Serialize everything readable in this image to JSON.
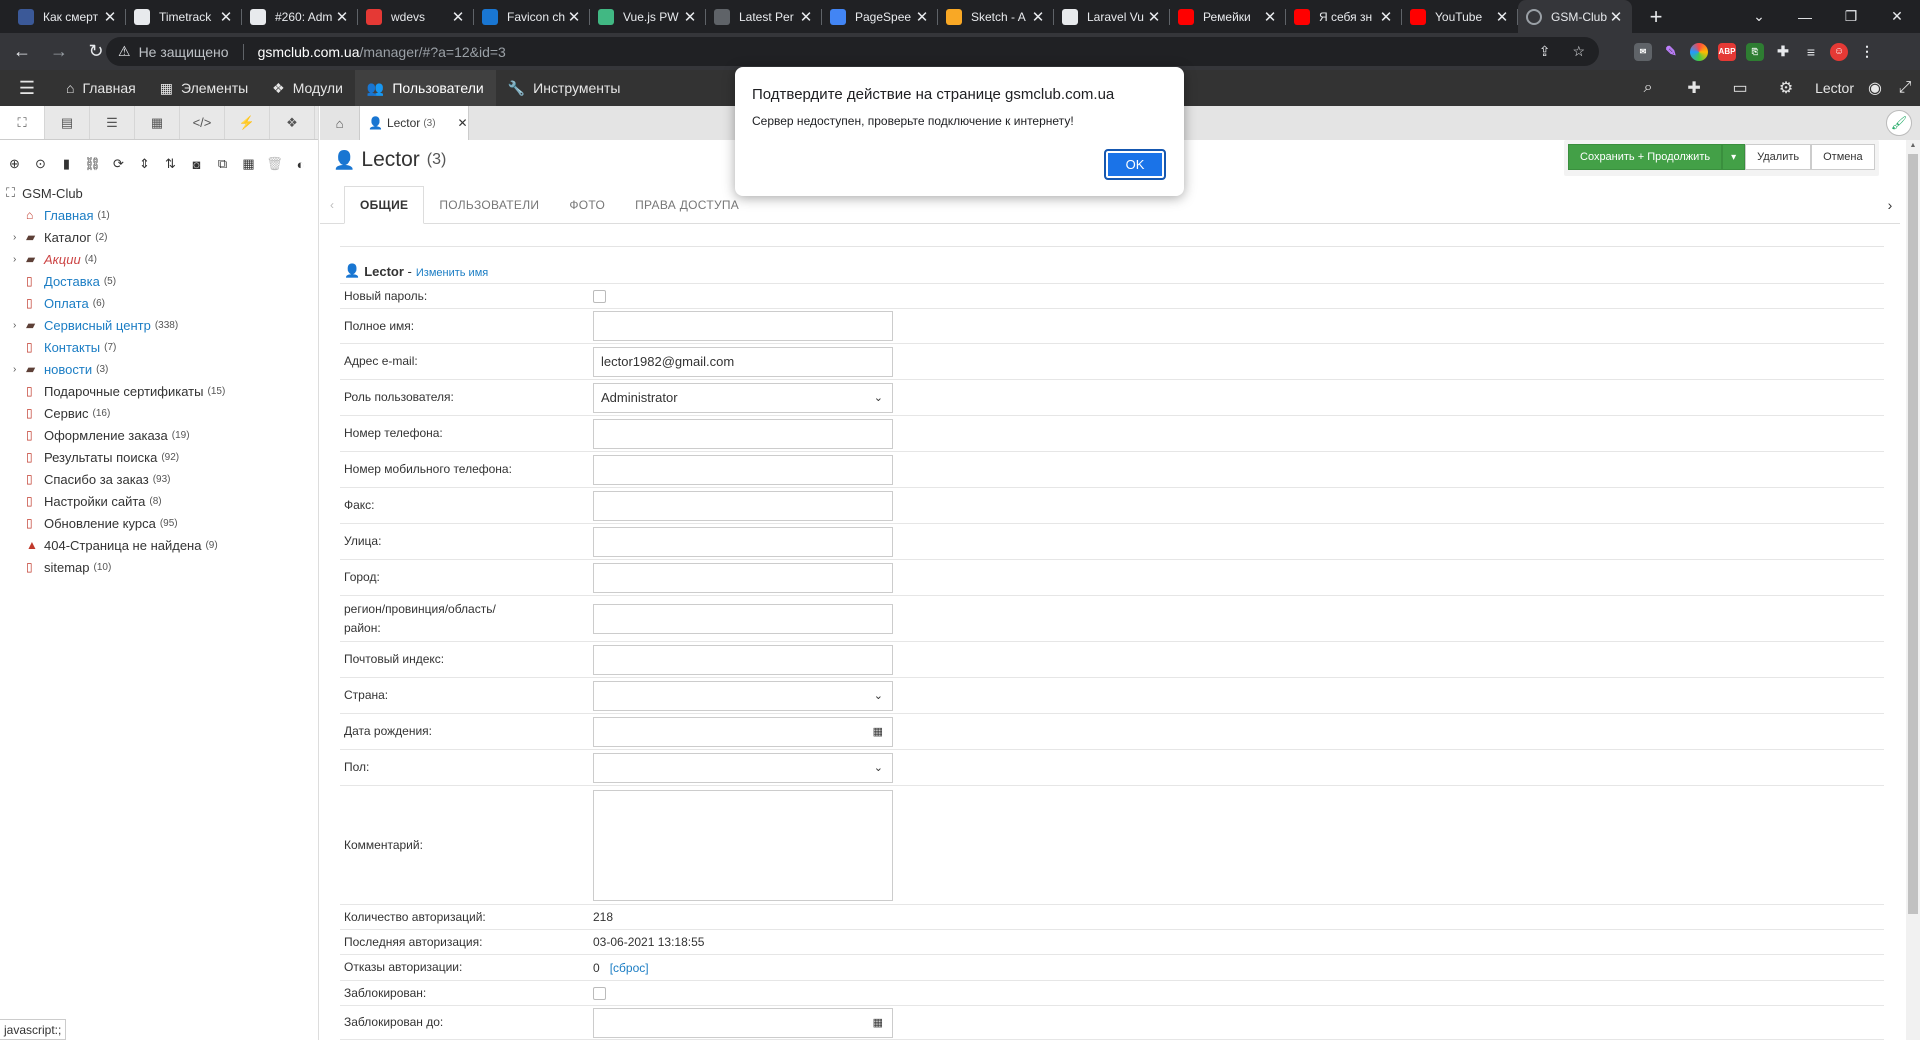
{
  "browser_tabs": [
    {
      "title": "Как смерт",
      "favicon_color": "#3b5998"
    },
    {
      "title": "Timetrack",
      "favicon_color": "#e8eaed"
    },
    {
      "title": "#260: Adm",
      "favicon_color": "#e8eaed"
    },
    {
      "title": "wdevs",
      "favicon_color": "#e53935"
    },
    {
      "title": "Favicon ch",
      "favicon_color": "#1976d2"
    },
    {
      "title": "Vue.js PW",
      "favicon_color": "#41b883"
    },
    {
      "title": "Latest Per",
      "favicon_color": "#5f6368"
    },
    {
      "title": "PageSpee",
      "favicon_color": "#4285f4"
    },
    {
      "title": "Sketch - A",
      "favicon_color": "#f9a825"
    },
    {
      "title": "Laravel Vu",
      "favicon_color": "#e8eaed"
    },
    {
      "title": "Ремейки",
      "favicon_color": "#ff0000"
    },
    {
      "title": "Я себя зн",
      "favicon_color": "#ff0000"
    },
    {
      "title": "YouTube",
      "favicon_color": "#ff0000"
    },
    {
      "title": "GSM-Club",
      "favicon_color": "#35363a",
      "active": true
    }
  ],
  "address_bar": {
    "security": "Не защищено",
    "host": "gsmclub.com.ua",
    "path": "/manager/#?a=12&id=3"
  },
  "main_nav": {
    "items": [
      {
        "label": "Главная",
        "icon": "home-icon"
      },
      {
        "label": "Элементы",
        "icon": "grid-icon"
      },
      {
        "label": "Модули",
        "icon": "cubes-icon"
      },
      {
        "label": "Пользователи",
        "icon": "users-icon",
        "active": true
      },
      {
        "label": "Инструменты",
        "icon": "wrench-icon"
      }
    ],
    "user": "Lector"
  },
  "tree": {
    "site": "GSM-Club",
    "nodes": [
      {
        "label": "Главная",
        "count": "(1)",
        "type": "home",
        "style": "link"
      },
      {
        "label": "Каталог",
        "count": "(2)",
        "type": "folder",
        "expandable": true
      },
      {
        "label": "Акции",
        "count": "(4)",
        "type": "folder",
        "expandable": true,
        "style": "em"
      },
      {
        "label": "Доставка",
        "count": "(5)",
        "type": "doc",
        "style": "link"
      },
      {
        "label": "Оплата",
        "count": "(6)",
        "type": "doc",
        "style": "link"
      },
      {
        "label": "Сервисный центр",
        "count": "(338)",
        "type": "folder",
        "expandable": true,
        "style": "link"
      },
      {
        "label": "Контакты",
        "count": "(7)",
        "type": "doc",
        "style": "link"
      },
      {
        "label": "новости",
        "count": "(3)",
        "type": "folder",
        "expandable": true,
        "style": "link"
      },
      {
        "label": "Подарочные сертификаты",
        "count": "(15)",
        "type": "doc"
      },
      {
        "label": "Сервис",
        "count": "(16)",
        "type": "doc"
      },
      {
        "label": "Оформление заказа",
        "count": "(19)",
        "type": "doc"
      },
      {
        "label": "Результаты поиска",
        "count": "(92)",
        "type": "doc"
      },
      {
        "label": "Спасибо за заказ",
        "count": "(93)",
        "type": "doc"
      },
      {
        "label": "Настройки сайта",
        "count": "(8)",
        "type": "doc"
      },
      {
        "label": "Обновление курса",
        "count": "(95)",
        "type": "doc"
      },
      {
        "label": "404-Страница не найдена",
        "count": "(9)",
        "type": "warning"
      },
      {
        "label": "sitemap",
        "count": "(10)",
        "type": "doc"
      }
    ]
  },
  "doc_tab": {
    "label": "Lector",
    "count": "(3)"
  },
  "page": {
    "title": "Lector",
    "count": "(3)"
  },
  "actions": {
    "save": "Сохранить + Продолжить",
    "delete": "Удалить",
    "cancel": "Отмена"
  },
  "form_tabs": [
    "ОБЩИЕ",
    "ПОЛЬЗОВАТЕЛИ",
    "ФОТО",
    "ПРАВА ДОСТУПА"
  ],
  "user_header": {
    "name": "Lector",
    "rename": "Изменить имя"
  },
  "fields": {
    "new_password": "Новый пароль:",
    "full_name": "Полное имя:",
    "email": "Адрес e-mail:",
    "email_value": "lector1982@gmail.com",
    "role": "Роль пользователя:",
    "role_value": "Administrator",
    "phone": "Номер телефона:",
    "mobile": "Номер мобильного телефона:",
    "fax": "Факс:",
    "street": "Улица:",
    "city": "Город:",
    "region": "регион/провинция/область/район:",
    "zip": "Почтовый индекс:",
    "country": "Страна:",
    "birthdate": "Дата рождения:",
    "gender": "Пол:",
    "comment": "Комментарий:",
    "logins": "Количество авторизаций:",
    "logins_value": "218",
    "last_login": "Последняя авторизация:",
    "last_login_value": "03-06-2021 13:18:55",
    "failed": "Отказы авторизации:",
    "failed_value": "0",
    "reset": "[сброс]",
    "blocked": "Заблокирован:",
    "blocked_until": "Заблокирован до:"
  },
  "dialog": {
    "title": "Подтвердите действие на странице gsmclub.com.ua",
    "message": "Сервер недоступен, проверьте подключение к интернету!",
    "ok": "OK"
  },
  "status_bar": "javascript:;"
}
